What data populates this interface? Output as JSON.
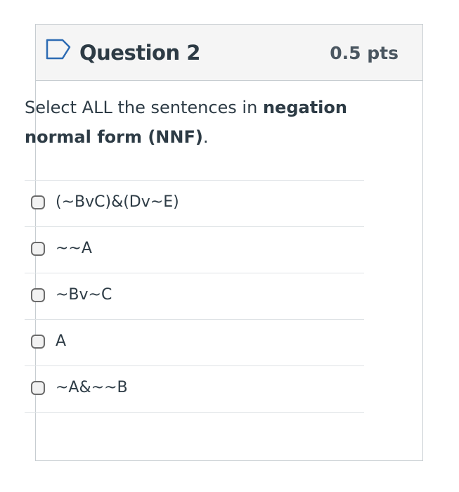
{
  "question": {
    "title": "Question 2",
    "points": "0.5 pts",
    "flag_icon": "flag-outline-icon",
    "prompt_parts": {
      "intro": "Select ALL the sentences in ",
      "bold": "negation normal form (NNF)",
      "end": "."
    }
  },
  "answers": [
    {
      "label": "(~BvC)&(Dv~E)",
      "checked": false
    },
    {
      "label": "~~A",
      "checked": false
    },
    {
      "label": "~Bv~C",
      "checked": false
    },
    {
      "label": "A",
      "checked": false
    },
    {
      "label": "~A&~~B",
      "checked": false
    }
  ],
  "colors": {
    "header_bg": "#f5f5f5",
    "border": "#c7cdd1",
    "text": "#2d3b45",
    "flag": "#2d6bb3"
  }
}
